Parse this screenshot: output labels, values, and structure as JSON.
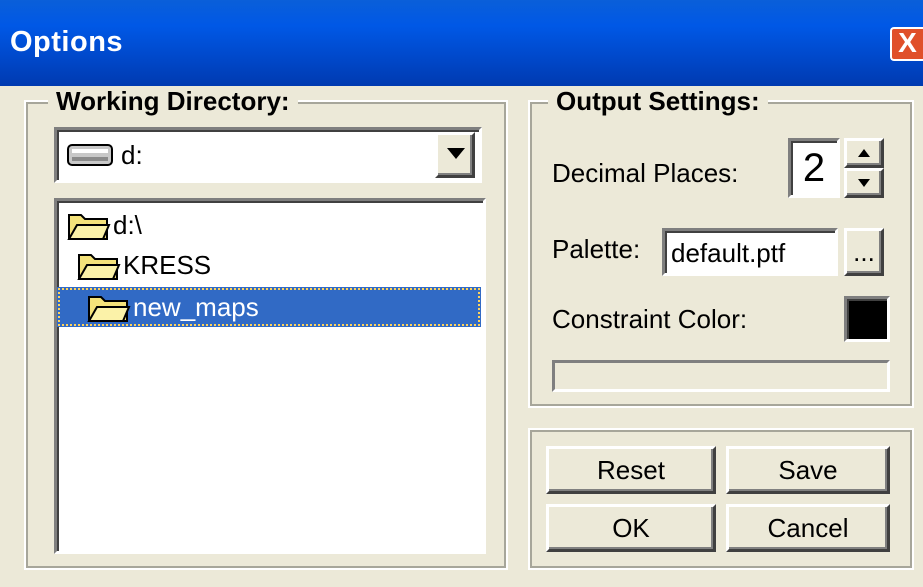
{
  "window": {
    "title": "Options",
    "close_glyph": "X"
  },
  "working_directory": {
    "legend": "Working Directory:",
    "drive": {
      "value": "d:",
      "icon": "drive-icon"
    },
    "tree": [
      {
        "label": "d:\\",
        "icon": "open-folder-icon",
        "selected": false
      },
      {
        "label": "KRESS",
        "icon": "open-folder-icon",
        "selected": false
      },
      {
        "label": "new_maps",
        "icon": "open-folder-icon",
        "selected": true
      }
    ]
  },
  "output_settings": {
    "legend": "Output Settings:",
    "decimal_places_label": "Decimal Places:",
    "decimal_places_value": "2",
    "palette_label": "Palette:",
    "palette_value": "default.ptf",
    "browse_label": "...",
    "constraint_color_label": "Constraint Color:",
    "constraint_color": "#000000"
  },
  "buttons": {
    "reset": "Reset",
    "save": "Save",
    "ok": "OK",
    "cancel": "Cancel"
  },
  "colors": {
    "selection": "#316ac5",
    "title_bar": "#0058e6",
    "close": "#e0502a"
  }
}
